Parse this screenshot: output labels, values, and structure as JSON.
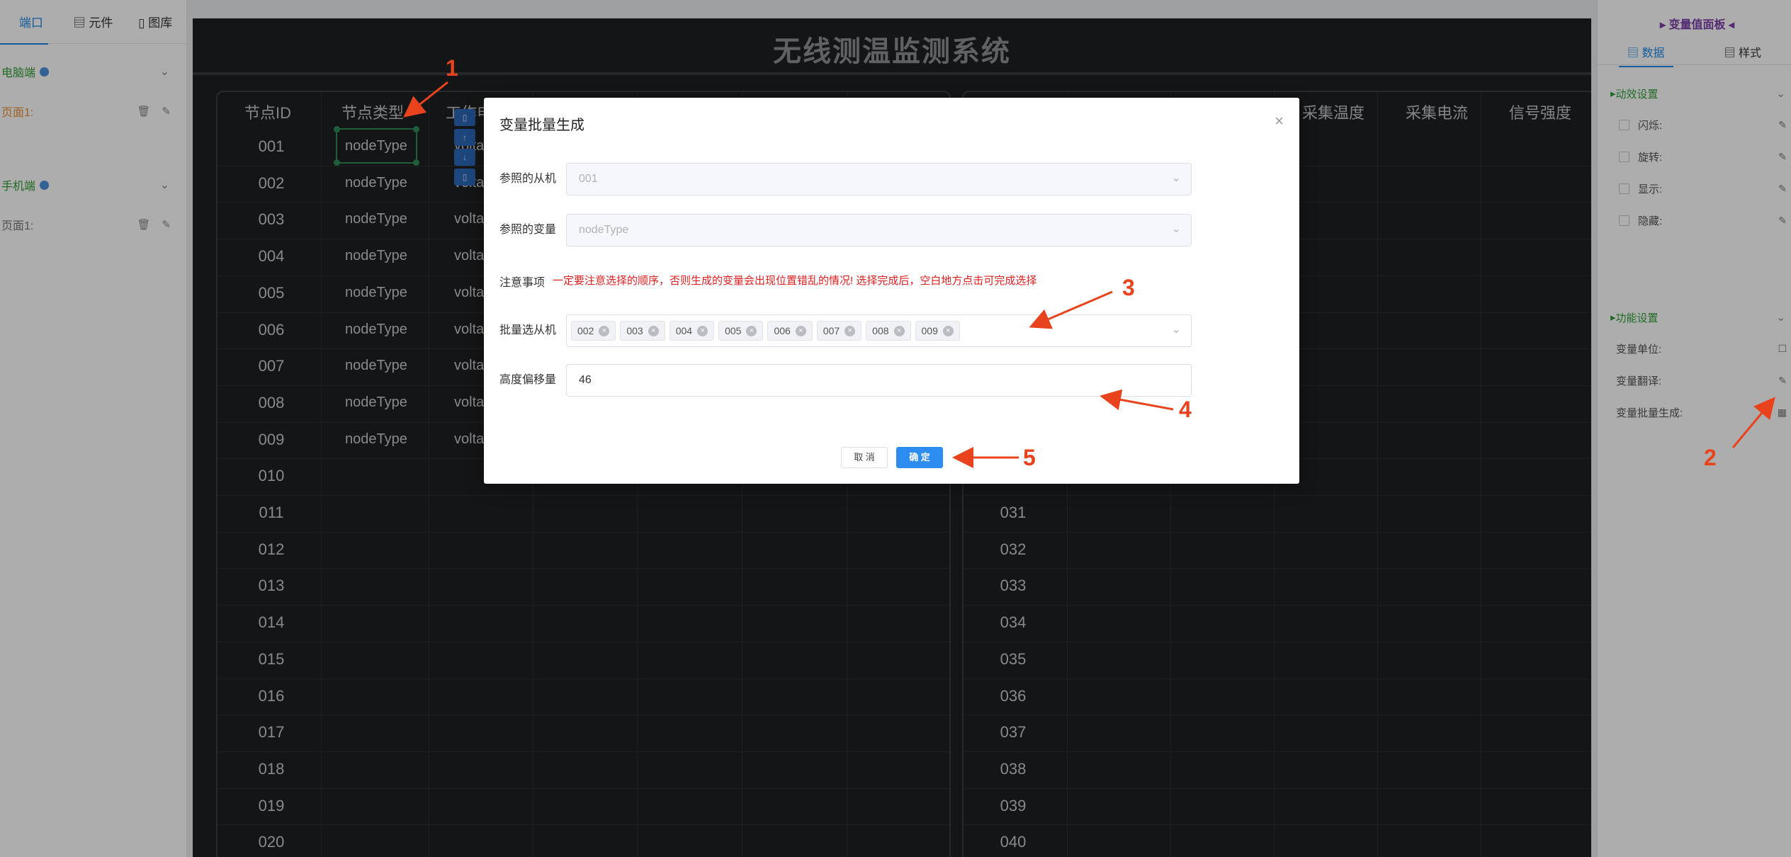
{
  "left_panel": {
    "tabs": [
      "端口",
      "元件",
      "图库"
    ],
    "groups": [
      {
        "name": "电脑端",
        "page": "页面1:"
      },
      {
        "name": "手机端",
        "page": "页面1:"
      }
    ]
  },
  "canvas": {
    "title": "无线测温监测系统",
    "left_table": {
      "headers": [
        "节点ID",
        "节点类型",
        "工作电"
      ],
      "ids": [
        "001",
        "002",
        "003",
        "004",
        "005",
        "006",
        "007",
        "008",
        "009",
        "010",
        "011",
        "012",
        "013",
        "014",
        "015",
        "016",
        "017",
        "018",
        "019",
        "020"
      ],
      "types": [
        "nodeType",
        "nodeType",
        "nodeType",
        "nodeType",
        "nodeType",
        "nodeType",
        "nodeType",
        "nodeType",
        "nodeType"
      ],
      "volt": [
        "volta",
        "volta",
        "volta",
        "volta",
        "volta",
        "volta",
        "volta",
        "volta",
        "volta"
      ]
    },
    "right_table": {
      "headers": [
        "采集温度",
        "采集电流",
        "信号强度"
      ],
      "ids": [
        "031",
        "032",
        "033",
        "034",
        "035",
        "036",
        "037",
        "038",
        "039",
        "040"
      ]
    }
  },
  "right_panel": {
    "title": "变量值面板",
    "tabs": [
      "数据",
      "样式"
    ],
    "anim_section": "动效设置",
    "anim_options": [
      "闪烁:",
      "旋转:",
      "显示:",
      "隐藏:"
    ],
    "func_section": "功能设置",
    "func_options": [
      "变量单位:",
      "变量翻译:",
      "变量批量生成:"
    ]
  },
  "dialog": {
    "title": "变量批量生成",
    "ref_slave_label": "参照的从机",
    "ref_slave_value": "001",
    "ref_var_label": "参照的变量",
    "ref_var_value": "nodeType",
    "notice_label": "注意事项",
    "notice_text": "一定要注意选择的顺序，否则生成的变量会出现位置错乱的情况! 选择完成后，空白地方点击可完成选择",
    "batch_label": "批量选从机",
    "batch_tags": [
      "002",
      "003",
      "004",
      "005",
      "006",
      "007",
      "008",
      "009"
    ],
    "offset_label": "高度偏移量",
    "offset_value": "46",
    "cancel": "取 消",
    "ok": "确 定"
  },
  "annotations": [
    "1",
    "2",
    "3",
    "4",
    "5"
  ],
  "colors": {
    "accent": "#2d8cf0",
    "notice": "#e02020",
    "annotation": "#e8431d",
    "canvas_bg": "#1e1f22"
  }
}
